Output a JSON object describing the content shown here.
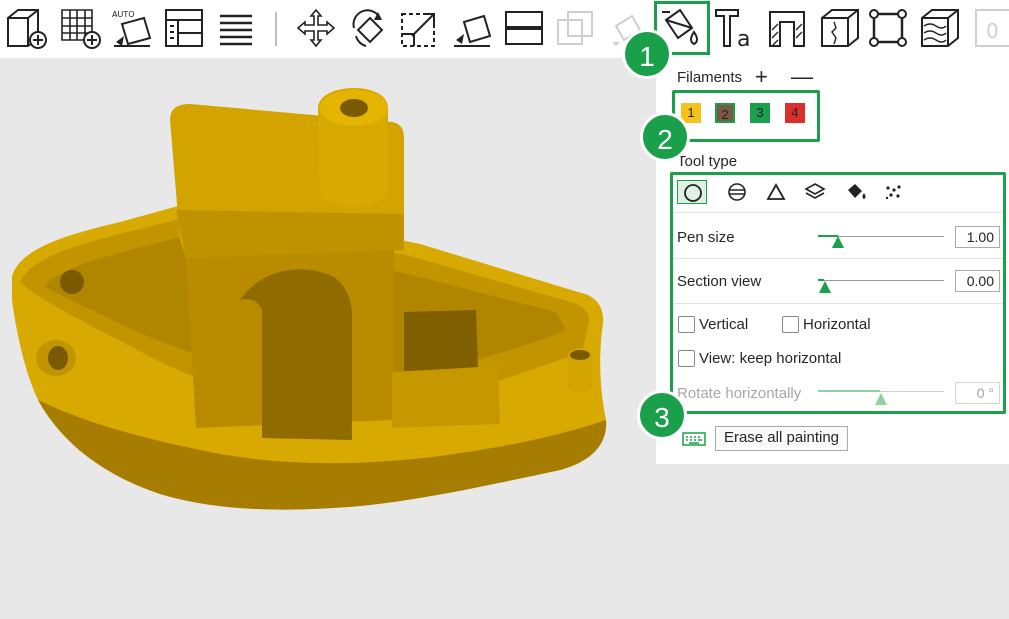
{
  "panel": {
    "filaments_label": "Filaments",
    "filament_add": "+",
    "filament_remove": "—",
    "filaments": [
      {
        "label": "1",
        "color": "#f4c21a"
      },
      {
        "label": "2",
        "color": "#7a5a45"
      },
      {
        "label": "3",
        "color": "#1aa04a"
      },
      {
        "label": "4",
        "color": "#d9302c"
      }
    ],
    "tool_type_label": "Tool type",
    "pen_size_label": "Pen size",
    "pen_size_value": "1.00",
    "section_view_label": "Section view",
    "section_view_value": "0.00",
    "vertical_label": "Vertical",
    "horizontal_label": "Horizontal",
    "keep_horizontal_label": "View: keep horizontal",
    "rotate_label": "Rotate horizontally",
    "rotate_value": "0 °",
    "erase_label": "Erase all painting"
  },
  "callouts": {
    "one": "1",
    "two": "2",
    "three": "3"
  },
  "colors": {
    "accent": "#1aa04a",
    "model": "#d8a900"
  }
}
